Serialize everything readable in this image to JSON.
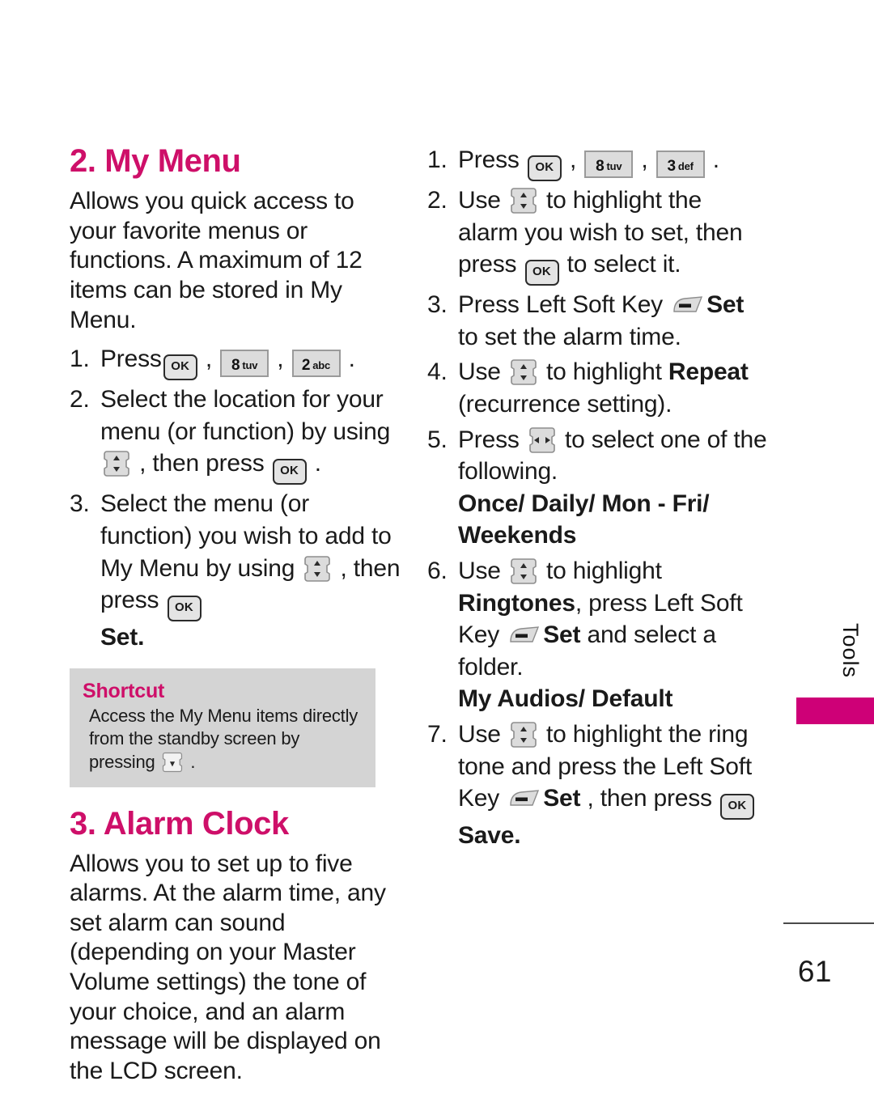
{
  "page": {
    "number": "61",
    "side_tab": "Tools",
    "accent_color": "#CE0F69",
    "tab_color": "#CE0077"
  },
  "left_column": {
    "section_my_menu": {
      "title": "2. My Menu",
      "intro": "Allows you quick access to your favorite menus or functions. A maximum of 12 items can be stored in My Menu.",
      "steps": [
        {
          "num": "1.",
          "parts": [
            {
              "type": "text",
              "value": "Press "
            },
            {
              "type": "key-ok",
              "value": "OK"
            },
            {
              "type": "text",
              "value": " , "
            },
            {
              "type": "key-num",
              "digit": "8",
              "letters": "tuv"
            },
            {
              "type": "text",
              "value": " , "
            },
            {
              "type": "key-num",
              "digit": "2",
              "letters": "abc"
            },
            {
              "type": "text",
              "value": " ."
            }
          ]
        },
        {
          "num": "2.",
          "parts": [
            {
              "type": "text",
              "value": "Select the location for your menu (or function) by using "
            },
            {
              "type": "key-updown",
              "value": "up-down-navigation-key"
            },
            {
              "type": "text",
              "value": " , then press "
            },
            {
              "type": "key-ok",
              "value": "OK"
            },
            {
              "type": "text",
              "value": " ."
            }
          ]
        },
        {
          "num": "3.",
          "parts": [
            {
              "type": "text",
              "value": "Select the menu (or function) you wish to add to My Menu by using "
            },
            {
              "type": "key-updown",
              "value": "up-down-navigation-key"
            },
            {
              "type": "text",
              "value": " , then press "
            },
            {
              "type": "key-ok",
              "value": "OK"
            },
            {
              "type": "bold",
              "value": "Set"
            },
            {
              "type": "bold",
              "value": "."
            }
          ]
        }
      ],
      "shortcut": {
        "title": "Shortcut",
        "text_before": "Access the My Menu items directly from the standby screen by pressing ",
        "key": "down-navigation-key",
        "text_after": " ."
      }
    },
    "section_alarm_clock": {
      "title": "3. Alarm Clock",
      "intro": "Allows you to set up to five alarms. At the alarm time, any set alarm can sound (depending on your Master Volume settings) the tone of your choice, and an alarm message will be displayed on the LCD screen."
    }
  },
  "right_column": {
    "steps": [
      {
        "num": "1.",
        "segments": [
          {
            "t": "text",
            "v": "Press "
          },
          {
            "t": "key-ok",
            "v": "OK"
          },
          {
            "t": "text",
            "v": " , "
          },
          {
            "t": "key-num",
            "digit": "8",
            "letters": "tuv"
          },
          {
            "t": "text",
            "v": " , "
          },
          {
            "t": "key-num",
            "digit": "3",
            "letters": "def"
          },
          {
            "t": "text",
            "v": " ."
          }
        ]
      },
      {
        "num": "2.",
        "segments": [
          {
            "t": "text",
            "v": "Use "
          },
          {
            "t": "key-updown",
            "v": "up-down-navigation-key"
          },
          {
            "t": "text",
            "v": " to highlight the alarm you wish to set, then press "
          },
          {
            "t": "key-ok",
            "v": "OK"
          },
          {
            "t": "text",
            "v": " to select it."
          }
        ]
      },
      {
        "num": "3.",
        "segments": [
          {
            "t": "text",
            "v": "Press Left Soft Key "
          },
          {
            "t": "key-soft",
            "v": "left-soft-key"
          },
          {
            "t": "bold",
            "v": "Set"
          },
          {
            "t": "text",
            "v": " to set the alarm time."
          }
        ]
      },
      {
        "num": "4.",
        "segments": [
          {
            "t": "text",
            "v": "Use "
          },
          {
            "t": "key-updown",
            "v": "up-down-navigation-key"
          },
          {
            "t": "text",
            "v": " to highlight "
          },
          {
            "t": "bold",
            "v": "Repeat"
          },
          {
            "t": "text",
            "v": " (recurrence setting)."
          }
        ]
      },
      {
        "num": "5.",
        "segments": [
          {
            "t": "text",
            "v": "Press "
          },
          {
            "t": "key-leftright",
            "v": "left-right-navigation-key"
          },
          {
            "t": "text",
            "v": " to select one of the following."
          }
        ],
        "options_line1": "Once/ Daily/ Mon - Fri/",
        "options_line2": "Weekends"
      },
      {
        "num": "6.",
        "segments": [
          {
            "t": "text",
            "v": "Use "
          },
          {
            "t": "key-updown",
            "v": "up-down-navigation-key"
          },
          {
            "t": "text",
            "v": " to highlight "
          },
          {
            "t": "bold",
            "v": "Ringtones"
          },
          {
            "t": "text",
            "v": ", press Left Soft Key "
          },
          {
            "t": "key-soft",
            "v": "left-soft-key"
          },
          {
            "t": "bold",
            "v": "Set"
          },
          {
            "t": "text",
            "v": " and select a folder."
          }
        ],
        "options_line1": "My Audios/ Default"
      },
      {
        "num": "7.",
        "segments": [
          {
            "t": "text",
            "v": "Use "
          },
          {
            "t": "key-updown",
            "v": "up-down-navigation-key"
          },
          {
            "t": "text",
            "v": " to highlight the ring tone and press the Left Soft Key "
          },
          {
            "t": "key-soft",
            "v": "left-soft-key"
          },
          {
            "t": "bold",
            "v": "Set"
          },
          {
            "t": "text",
            "v": " , then press "
          },
          {
            "t": "key-ok",
            "v": "OK"
          },
          {
            "t": "bold",
            "v": "Save"
          },
          {
            "t": "bold",
            "v": "."
          }
        ]
      }
    ]
  }
}
